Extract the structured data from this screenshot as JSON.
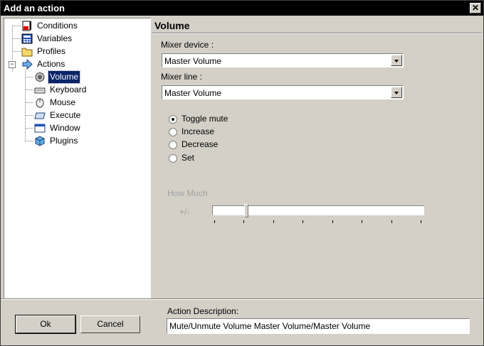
{
  "window": {
    "title": "Add an action",
    "close_glyph": "✕"
  },
  "tree": {
    "items": [
      {
        "label": "Conditions",
        "icon": "conditions-icon"
      },
      {
        "label": "Variables",
        "icon": "variables-icon"
      },
      {
        "label": "Profiles",
        "icon": "folder-icon"
      },
      {
        "label": "Actions",
        "icon": "actions-arrow-icon",
        "expanded": true
      },
      {
        "label": "Volume",
        "icon": "speaker-icon",
        "selected": true
      },
      {
        "label": "Keyboard",
        "icon": "keyboard-icon"
      },
      {
        "label": "Mouse",
        "icon": "mouse-icon"
      },
      {
        "label": "Execute",
        "icon": "execute-icon"
      },
      {
        "label": "Window",
        "icon": "window-icon"
      },
      {
        "label": "Plugins",
        "icon": "plugin-box-icon"
      }
    ],
    "expander_glyph": "−"
  },
  "panel": {
    "title": "Volume",
    "mixer_device": {
      "label": "Mixer device :",
      "value": "Master Volume"
    },
    "mixer_line": {
      "label": "Mixer line :",
      "value": "Master Volume"
    },
    "options": [
      {
        "label": "Toggle mute",
        "checked": true
      },
      {
        "label": "Increase",
        "checked": false
      },
      {
        "label": "Decrease",
        "checked": false
      },
      {
        "label": "Set",
        "checked": false
      }
    ],
    "how_much": {
      "label": "How Much",
      "unit": "+/-",
      "value_fraction": 0.15,
      "tick_count": 8,
      "enabled": false
    }
  },
  "footer": {
    "ok_label": "Ok",
    "cancel_label": "Cancel",
    "description_label": "Action Description:",
    "description_value": "Mute/Unmute Volume Master Volume/Master Volume"
  },
  "colors": {
    "selection": "#0a246a",
    "titlebar": "#000000",
    "face": "#d4d0c8"
  }
}
